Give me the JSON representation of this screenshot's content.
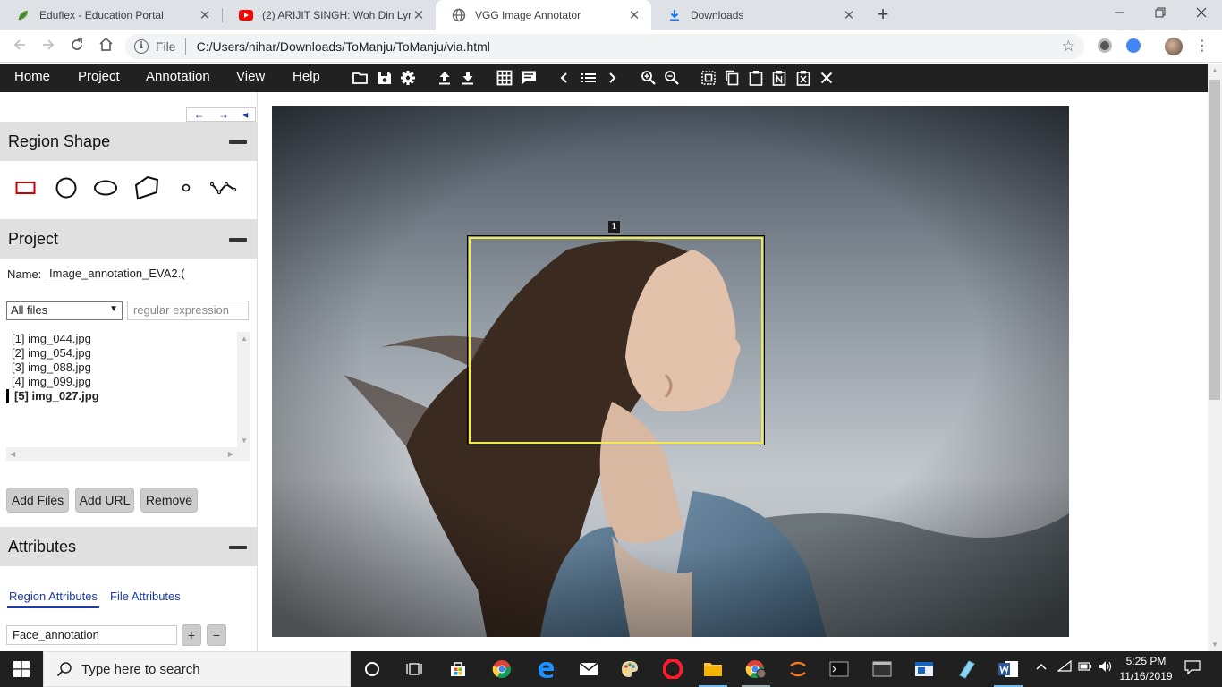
{
  "browser": {
    "tabs": [
      {
        "title": "Eduflex - Education Portal",
        "icon": "leaf-icon"
      },
      {
        "title": "(2) ARIJIT SINGH: Woh Din Lyrical",
        "icon": "youtube-icon"
      },
      {
        "title": "VGG Image Annotator",
        "icon": "globe-icon",
        "active": true
      },
      {
        "title": "Downloads",
        "icon": "download-icon"
      }
    ],
    "close_glyph": "✕",
    "new_tab": "+",
    "scheme_label": "File",
    "url": "C:/Users/nihar/Downloads/ToManju/ToManju/via.html"
  },
  "via": {
    "menu": [
      "Home",
      "Project",
      "Annotation",
      "View",
      "Help"
    ],
    "toolbar_icons": [
      "folder-open-icon",
      "save-icon",
      "settings-icon",
      "upload-icon",
      "download-icon",
      "grid-view-icon",
      "comment-icon",
      "prev-icon",
      "list-icon",
      "next-icon",
      "zoom-in-icon",
      "zoom-out-icon",
      "select-all-icon",
      "copy-icon",
      "paste-icon",
      "paste-n-icon",
      "delete-region-icon",
      "close-icon"
    ],
    "left_panel": {
      "nav": {
        "left": "←",
        "right": "→",
        "collapse": "◂"
      },
      "region_shape": {
        "title": "Region Shape",
        "shapes": [
          "rectangle",
          "circle",
          "ellipse",
          "polygon",
          "point",
          "polyline"
        ],
        "selected": "rectangle",
        "selected_color": "#cc0000"
      },
      "project": {
        "title": "Project",
        "name_label": "Name:",
        "name_value": "Image_annotation_EVA2.(",
        "filter_value": "All files",
        "regex_placeholder": "regular expression",
        "files": [
          "[1] img_044.jpg",
          "[2] img_054.jpg",
          "[3] img_088.jpg",
          "[4] img_099.jpg",
          "[5] img_027.jpg"
        ],
        "current_file_index": 4,
        "buttons": {
          "add_files": "Add Files",
          "add_url": "Add URL",
          "remove": "Remove"
        }
      },
      "attributes": {
        "title": "Attributes",
        "tabs": {
          "region": "Region Attributes",
          "file": "File Attributes"
        },
        "attr_value": "Face_annotation",
        "add": "+",
        "remove": "−"
      }
    },
    "canvas": {
      "region_label": "1",
      "region_color": "#f2e94a"
    }
  },
  "taskbar": {
    "search_placeholder": "Type here to search",
    "time": "5:25 PM",
    "date": "11/16/2019"
  }
}
